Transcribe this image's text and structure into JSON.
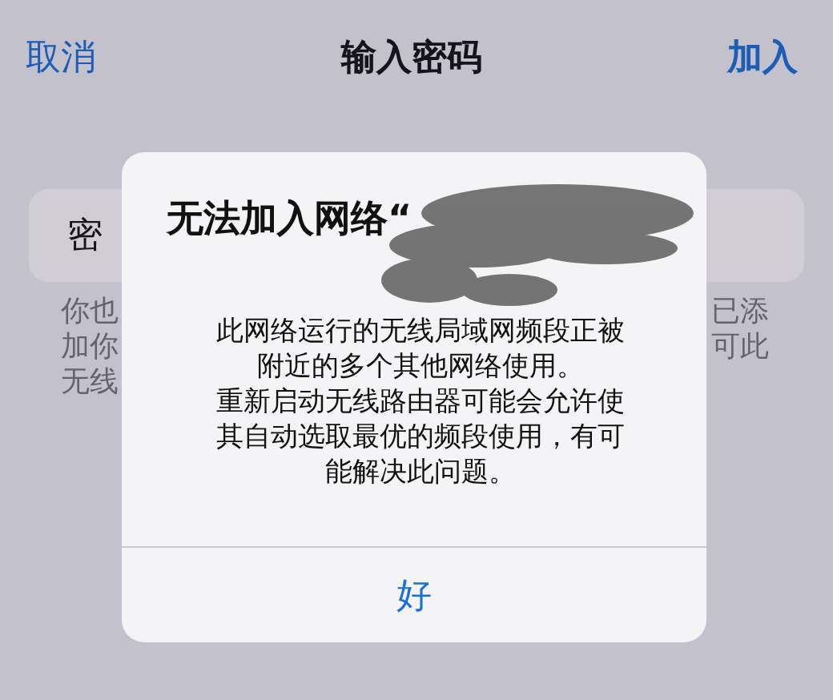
{
  "nav": {
    "cancel": "取消",
    "title": "输入密码",
    "join": "加入"
  },
  "password_field": {
    "label": "密"
  },
  "footnote": {
    "left_lines": [
      "你也",
      "加你",
      "无线"
    ],
    "right_lines": [
      "已添",
      "可此"
    ]
  },
  "alert": {
    "title": "无法加入网络“",
    "name_redacted": true,
    "message_lines": [
      "此网络运行的无线局域网频段正被",
      "附近的多个其他网络使用。",
      "重新启动无线路由器可能会允许使",
      "其自动选取最优的频段使用，有可",
      "能解决此问题。"
    ],
    "button": "好"
  }
}
